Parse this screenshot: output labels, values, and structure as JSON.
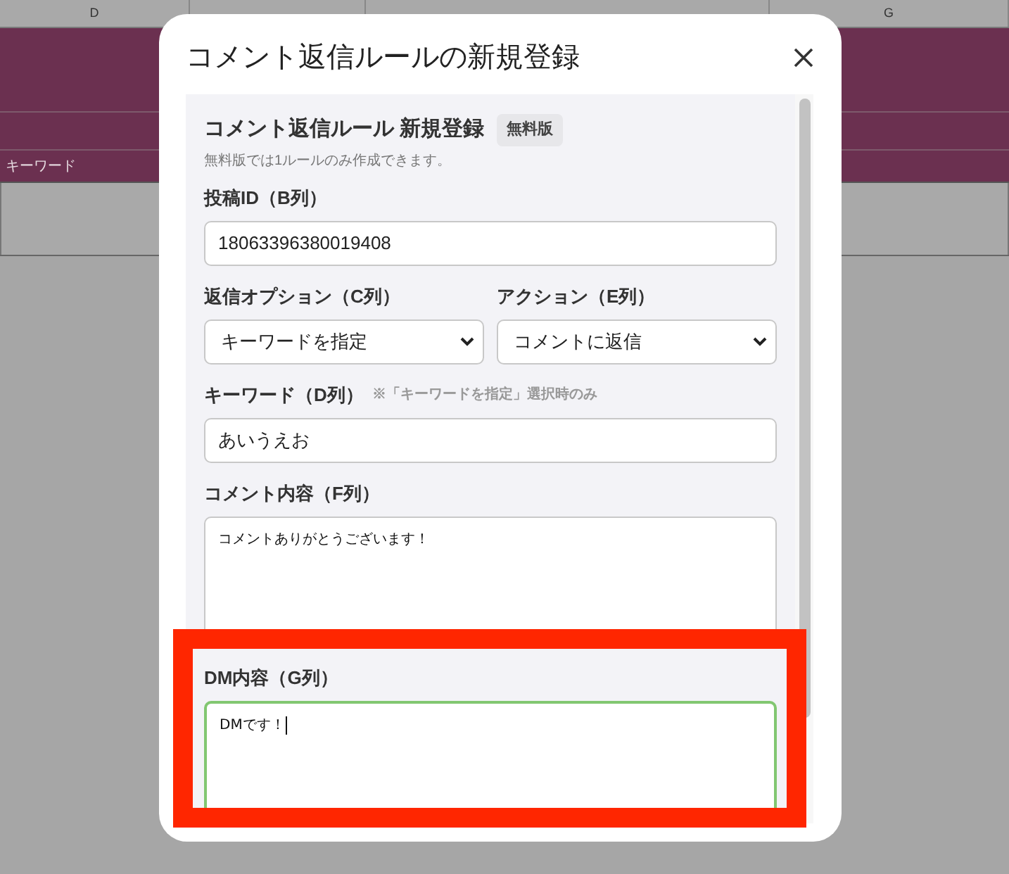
{
  "sheet": {
    "columns": [
      "D",
      "G"
    ],
    "keyword_cell": "キーワード"
  },
  "dialog": {
    "title": "コメント返信ルールの新規登録",
    "heading": "コメント返信ルール 新規登録",
    "badge": "無料版",
    "note": "無料版では1ルールのみ作成できます。",
    "fields": [
      {
        "kind": "text",
        "label": "投稿ID（B列）",
        "value": "18063396380019408",
        "focused": false
      },
      {
        "kind": "select_pair",
        "items": [
          {
            "label": "返信オプション（C列）",
            "value": "キーワードを指定"
          },
          {
            "label": "アクション（E列）",
            "value": "コメントに返信"
          }
        ]
      },
      {
        "kind": "text",
        "label": "キーワード（D列）",
        "hint": "※「キーワードを指定」選択時のみ",
        "value": "あいうえお",
        "focused": false
      },
      {
        "kind": "textarea",
        "label": "コメント内容（F列）",
        "value": "コメントありがとうございます！",
        "focused": false
      },
      {
        "kind": "textarea",
        "label": "DM内容（G列）",
        "value": "DMです！",
        "focused": true
      }
    ]
  }
}
